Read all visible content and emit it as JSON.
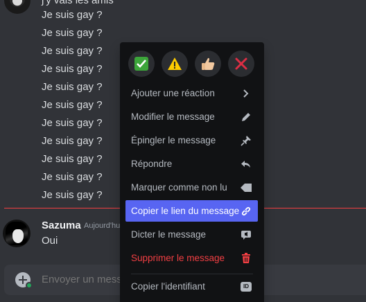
{
  "chat": {
    "cut_line": "j'y vais les amis",
    "messages": [
      "Je suis gay ?",
      "Je suis gay ?",
      "Je suis gay ?",
      "Je suis gay ?",
      "Je suis gay ?",
      "Je suis gay ?",
      "Je suis gay ?",
      "Je suis gay ?",
      "Je suis gay ?",
      "Je suis gay ?",
      "Je suis gay ?"
    ],
    "author": {
      "name": "Sazuma",
      "timestamp": "Aujourd'hui",
      "message": "Oui"
    },
    "composer": {
      "placeholder": "Envoyer un message"
    }
  },
  "menu": {
    "reactions": [
      "white-check-mark-icon",
      "warning-icon",
      "thumbs-up-icon",
      "cross-mark-icon"
    ],
    "items": [
      {
        "label": "Ajouter une réaction",
        "icon": "chevron-right-icon"
      },
      {
        "label": "Modifier le message",
        "icon": "pencil-icon"
      },
      {
        "label": "Épingler le message",
        "icon": "pin-icon"
      },
      {
        "label": "Répondre",
        "icon": "reply-icon"
      },
      {
        "label": "Marquer comme non lu",
        "icon": "unread-flag-icon"
      },
      {
        "label": "Copier le lien du message",
        "icon": "link-icon"
      },
      {
        "label": "Dicter le message",
        "icon": "speech-icon"
      },
      {
        "label": "Supprimer le message",
        "icon": "trash-icon"
      },
      {
        "label": "Copier l'identifiant",
        "icon": "id-icon",
        "badge": "ID"
      }
    ]
  },
  "colors": {
    "accent": "#5865f2",
    "danger": "#f23f43",
    "online": "#23a55a"
  }
}
